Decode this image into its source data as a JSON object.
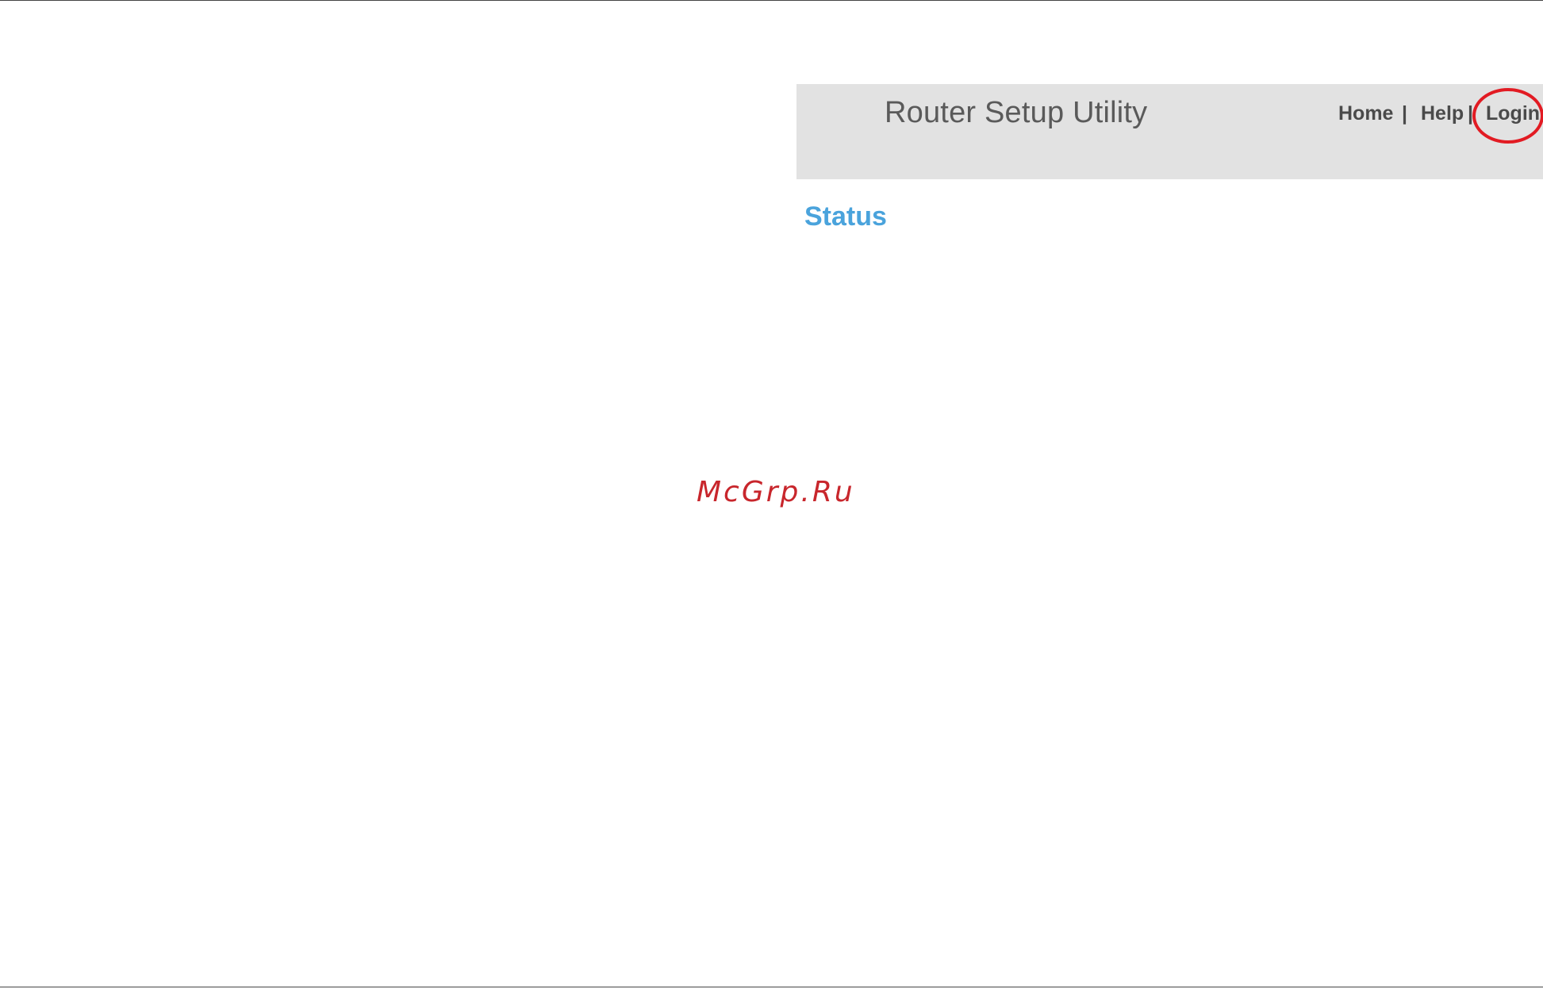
{
  "app": {
    "title": "Router Setup Utility"
  },
  "nav": {
    "home": "Home",
    "help": "Help",
    "login": "Login",
    "separator": "|"
  },
  "section": {
    "heading": "Status"
  },
  "watermark": {
    "text": "McGrp.Ru"
  },
  "colors": {
    "header_bg": "#e2e2e2",
    "heading_blue": "#4aa3dc",
    "highlight_red": "#e21b23",
    "watermark_red": "#c8262c"
  }
}
